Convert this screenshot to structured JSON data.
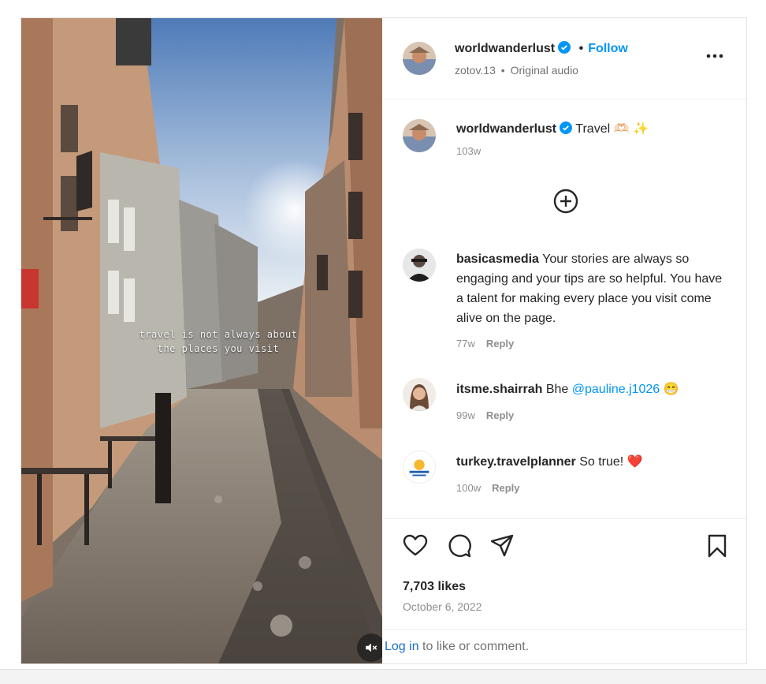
{
  "post": {
    "author": "worldwanderlust",
    "follow_label": "Follow",
    "separator": "•",
    "audio_user": "zotov.13",
    "audio_label": "Original audio",
    "caption_text": "Travel 🫶🏻 ✨",
    "caption_time": "103w",
    "overlay_line1": "travel is not always about",
    "overlay_line2": "the places you visit",
    "likes": "7,703 likes",
    "date": "October 6, 2022",
    "login_link": "Log in",
    "login_suffix": " to like or comment."
  },
  "comments": [
    {
      "user": "basicasmedia",
      "text": "Your stories are always so engaging and your tips are so helpful. You have a talent for making every place you visit come alive on the page.",
      "time": "77w",
      "reply": "Reply"
    },
    {
      "user": "itsme.shairrah",
      "text": "Bhe",
      "mention": "@pauline.j1026",
      "emoji": "😁",
      "time": "99w",
      "reply": "Reply"
    },
    {
      "user": "turkey.travelplanner",
      "text": "So true!",
      "emoji": "❤️",
      "time": "100w",
      "reply": "Reply"
    }
  ],
  "icons": {
    "verified": "verified-badge-icon",
    "more": "more-options-icon",
    "load_more": "plus-circle-icon",
    "like": "heart-icon",
    "comment": "comment-icon",
    "share": "paper-plane-icon",
    "save": "bookmark-icon",
    "mute": "speaker-muted-icon"
  },
  "colors": {
    "accent": "#0095f6",
    "verified": "#0095f6",
    "text": "#262626",
    "muted": "#8e8e8e",
    "heart": "#e0245e"
  }
}
